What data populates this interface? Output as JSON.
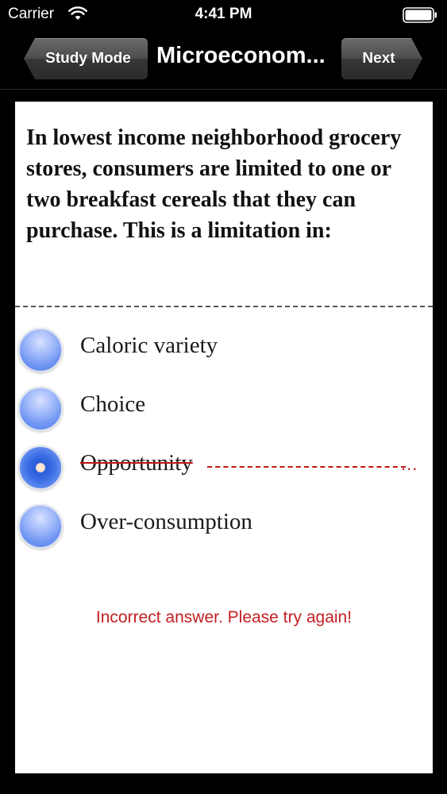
{
  "status_bar": {
    "carrier": "Carrier",
    "time": "4:41 PM",
    "wifi_icon": "wifi-icon",
    "battery_icon": "battery-full-icon"
  },
  "nav": {
    "back_label": "Study Mode",
    "title": "Microeconom...",
    "next_label": "Next"
  },
  "question": {
    "text": "In lowest income neighborhood grocery stores, consumers are limited to one or two breakfast cereals that they can purchase. This is a limitation in:"
  },
  "options": [
    {
      "label": "Caloric variety",
      "selected": false,
      "crossed_out": false
    },
    {
      "label": "Choice",
      "selected": false,
      "crossed_out": false
    },
    {
      "label": "Opportunity",
      "selected": true,
      "crossed_out": true,
      "trailing_mark": "..."
    },
    {
      "label": "Over-consumption",
      "selected": false,
      "crossed_out": false
    }
  ],
  "feedback": {
    "text": "Incorrect answer. Please try again!",
    "color": "#c41e22"
  },
  "colors": {
    "background": "#000000",
    "card": "#ffffff",
    "radio_blue": "#6c93f2",
    "error_red": "#c41e22"
  }
}
